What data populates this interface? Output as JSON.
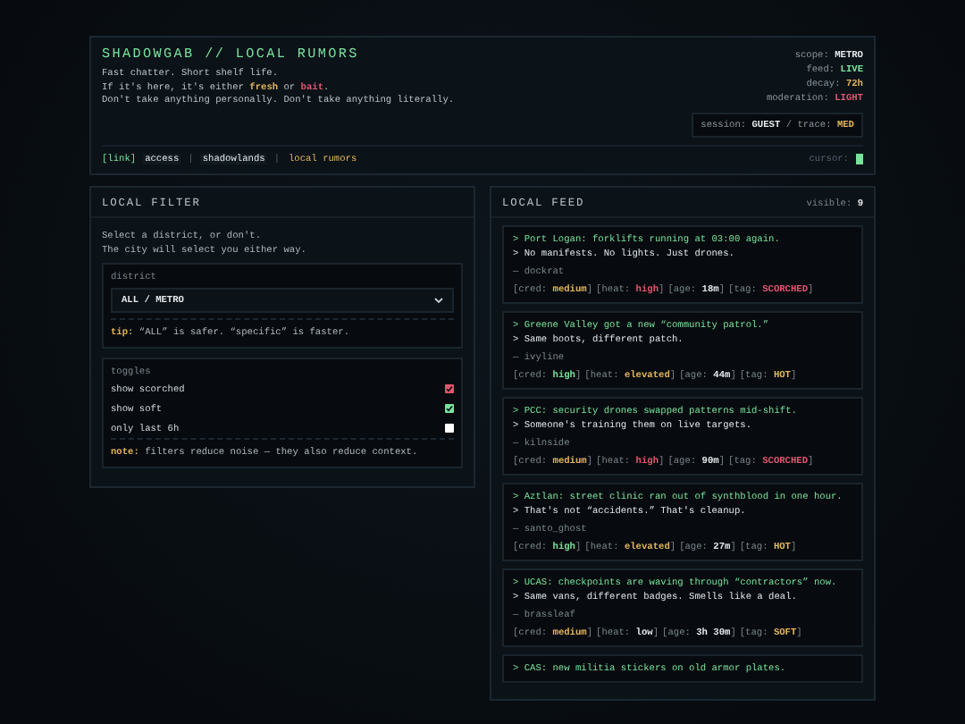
{
  "header": {
    "title": "SHADOWGAB // LOCAL RUMORS",
    "intro": [
      [
        {
          "text": "Fast chatter. Short shelf life."
        }
      ],
      [
        {
          "text": "If it's here, it's either "
        },
        {
          "text": "fresh",
          "color": "#e3b55c"
        },
        {
          "text": " or "
        },
        {
          "text": "bait",
          "color": "#e0566f"
        },
        {
          "text": "."
        }
      ],
      [
        {
          "text": "Don't take anything personally. Don't take anything literally."
        }
      ]
    ],
    "stats": [
      {
        "label": "scope:",
        "value": "METRO",
        "color": "#e4e8ea"
      },
      {
        "label": "feed:",
        "value": "LIVE",
        "color": "#79e29c"
      },
      {
        "label": "decay:",
        "value": "72h",
        "color": "#e3b55c"
      },
      {
        "label": "moderation:",
        "value": "LIGHT",
        "color": "#e0566f"
      }
    ],
    "session": [
      {
        "text": "session: "
      },
      {
        "text": "GUEST",
        "color": "#e4e8ea"
      },
      {
        "text": " / trace: "
      },
      {
        "text": "MED",
        "color": "#e3b55c"
      }
    ],
    "breadcrumb_prefix": "[link]",
    "breadcrumbs": [
      {
        "label": "access",
        "selected": false
      },
      {
        "label": "shadowlands",
        "selected": false
      },
      {
        "label": "local rumors",
        "selected": true
      }
    ],
    "separator": "|",
    "cursor_label": "cursor:"
  },
  "filter": {
    "title": "LOCAL FILTER",
    "intro": [
      "Select a district, or don't.",
      "The city will select you either way."
    ],
    "district": {
      "label": "district",
      "value": "ALL / METRO",
      "tip_label": "tip:",
      "tip": "“ALL” is safer. “specific” is faster."
    },
    "toggles": {
      "label": "toggles",
      "items": [
        {
          "label": "show scorched",
          "checked": true,
          "color": "#e0566f"
        },
        {
          "label": "show soft",
          "checked": true,
          "color": "#79e29c"
        },
        {
          "label": "only last 6h",
          "checked": false,
          "color": "#ffffff"
        }
      ],
      "note_label": "note:",
      "note": "filters reduce noise — they also reduce context."
    }
  },
  "feed": {
    "title": "LOCAL FEED",
    "visible_label": "visible:",
    "visible": "9",
    "posts": [
      {
        "lines": [
          "> Port Logan: forklifts running at 03:00 again.",
          "> No manifests. No lights. Just drones."
        ],
        "author": "— dockrat",
        "meta": [
          {
            "open": "[cred:",
            "value": "medium",
            "close": "]",
            "color": "#e3b55c"
          },
          {
            "open": "[heat:",
            "value": "high",
            "close": "]",
            "color": "#e0566f"
          },
          {
            "open": "[age:",
            "value": "18m",
            "close": "]",
            "color": "#e4e8ea"
          },
          {
            "open": "[tag:",
            "value": "SCORCHED",
            "close": "]",
            "color": "#e0566f"
          }
        ]
      },
      {
        "lines": [
          "> Greene Valley got a new “community patrol.”",
          "> Same boots, different patch."
        ],
        "author": "— ivyline",
        "meta": [
          {
            "open": "[cred:",
            "value": "high",
            "close": "]",
            "color": "#79e29c"
          },
          {
            "open": "[heat:",
            "value": "elevated",
            "close": "]",
            "color": "#e3b55c"
          },
          {
            "open": "[age:",
            "value": "44m",
            "close": "]",
            "color": "#e4e8ea"
          },
          {
            "open": "[tag:",
            "value": "HOT",
            "close": "]",
            "color": "#e3b55c"
          }
        ]
      },
      {
        "lines": [
          "> PCC: security drones swapped patterns mid-shift.",
          "> Someone's training them on live targets."
        ],
        "author": "— kilnside",
        "meta": [
          {
            "open": "[cred:",
            "value": "medium",
            "close": "]",
            "color": "#e3b55c"
          },
          {
            "open": "[heat:",
            "value": "high",
            "close": "]",
            "color": "#e0566f"
          },
          {
            "open": "[age:",
            "value": "90m",
            "close": "]",
            "color": "#e4e8ea"
          },
          {
            "open": "[tag:",
            "value": "SCORCHED",
            "close": "]",
            "color": "#e0566f"
          }
        ]
      },
      {
        "lines": [
          "> Aztlan: street clinic ran out of synthblood in one hour.",
          "> That's not “accidents.” That's cleanup."
        ],
        "author": "— santo_ghost",
        "meta": [
          {
            "open": "[cred:",
            "value": "high",
            "close": "]",
            "color": "#79e29c"
          },
          {
            "open": "[heat:",
            "value": "elevated",
            "close": "]",
            "color": "#e3b55c"
          },
          {
            "open": "[age:",
            "value": "27m",
            "close": "]",
            "color": "#e4e8ea"
          },
          {
            "open": "[tag:",
            "value": "HOT",
            "close": "]",
            "color": "#e3b55c"
          }
        ]
      },
      {
        "lines": [
          "> UCAS: checkpoints are waving through “contractors” now.",
          "> Same vans, different badges. Smells like a deal."
        ],
        "author": "— brassleaf",
        "meta": [
          {
            "open": "[cred:",
            "value": "medium",
            "close": "]",
            "color": "#e3b55c"
          },
          {
            "open": "[heat:",
            "value": "low",
            "close": "]",
            "color": "#e4e8ea"
          },
          {
            "open": "[age:",
            "value": "3h 30m",
            "close": "]",
            "color": "#e4e8ea"
          },
          {
            "open": "[tag:",
            "value": "SOFT",
            "close": "]",
            "color": "#e3b55c"
          }
        ]
      },
      {
        "lines": [
          "> CAS: new militia stickers on old armor plates."
        ]
      }
    ]
  }
}
